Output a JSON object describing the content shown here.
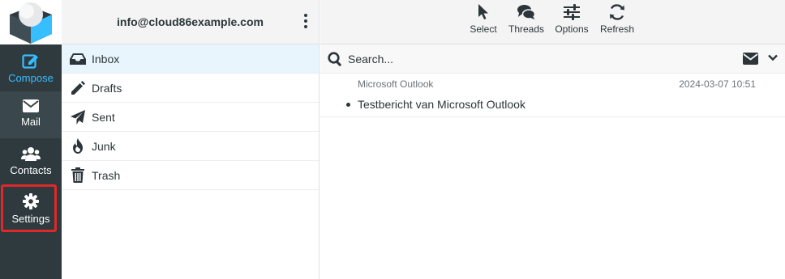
{
  "nav": {
    "compose": "Compose",
    "mail": "Mail",
    "contacts": "Contacts",
    "settings": "Settings",
    "icons": {
      "compose": "edit-icon",
      "mail": "envelope-icon",
      "contacts": "users-icon",
      "settings": "gear-icon"
    }
  },
  "folders": {
    "account": "info@cloud86example.com",
    "items": [
      {
        "label": "Inbox",
        "icon": "inbox-icon",
        "selected": true
      },
      {
        "label": "Drafts",
        "icon": "pencil-icon"
      },
      {
        "label": "Sent",
        "icon": "paper-plane-icon"
      },
      {
        "label": "Junk",
        "icon": "fire-icon"
      },
      {
        "label": "Trash",
        "icon": "trash-icon"
      }
    ]
  },
  "toolbar": {
    "select": "Select",
    "threads": "Threads",
    "options": "Options",
    "refresh": "Refresh"
  },
  "search": {
    "placeholder": "Search..."
  },
  "messages": [
    {
      "from": "Microsoft Outlook",
      "date": "2024-03-07 10:51",
      "subject": "Testbericht van Microsoft Outlook",
      "unread": true
    }
  ],
  "colors": {
    "nav_bg": "#2f3a3f",
    "accent": "#37beff",
    "selected_folder": "#e9f5fc",
    "highlight": "#e0282a"
  }
}
